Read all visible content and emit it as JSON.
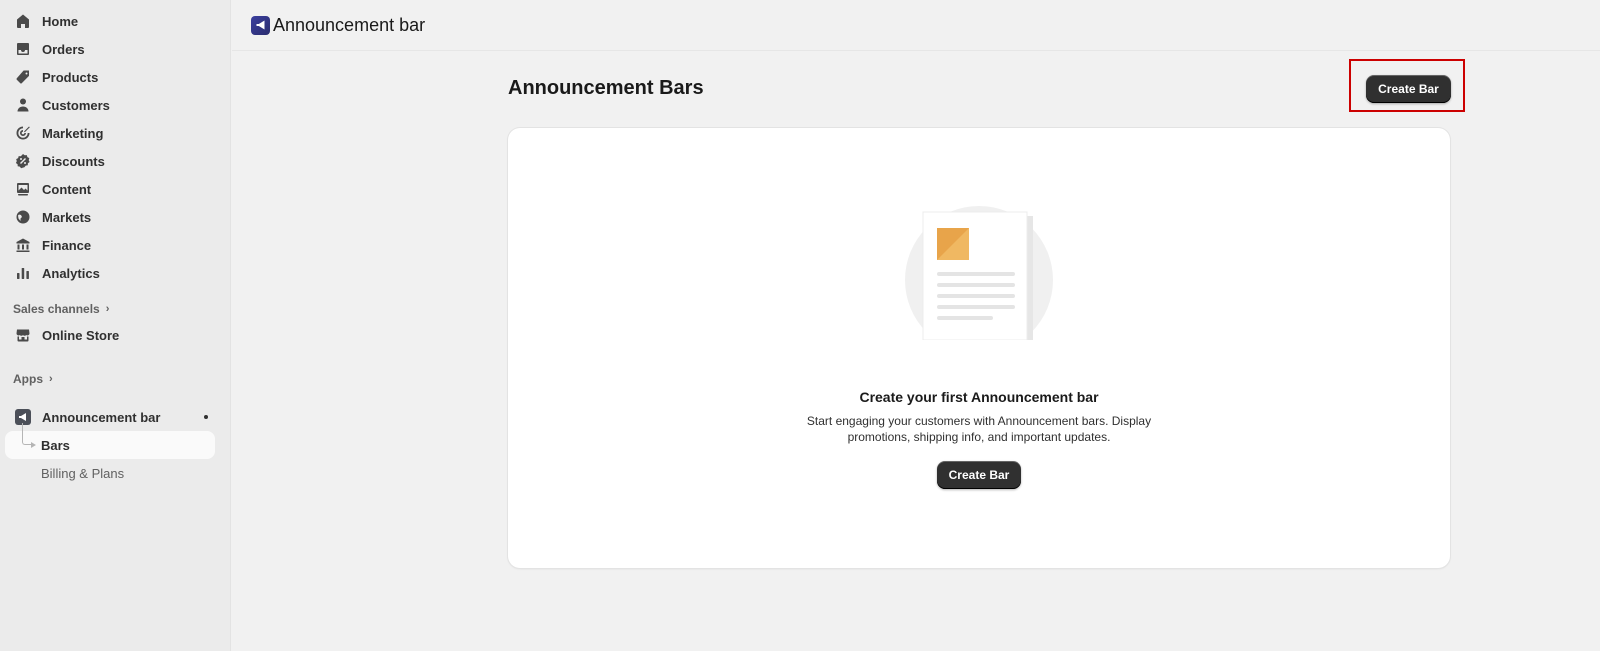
{
  "sidebar": {
    "nav": [
      {
        "label": "Home",
        "icon": "home-icon"
      },
      {
        "label": "Orders",
        "icon": "inbox-icon"
      },
      {
        "label": "Products",
        "icon": "tag-icon"
      },
      {
        "label": "Customers",
        "icon": "person-icon"
      },
      {
        "label": "Marketing",
        "icon": "target-icon"
      },
      {
        "label": "Discounts",
        "icon": "discount-icon"
      },
      {
        "label": "Content",
        "icon": "image-icon"
      },
      {
        "label": "Markets",
        "icon": "globe-icon"
      },
      {
        "label": "Finance",
        "icon": "bank-icon"
      },
      {
        "label": "Analytics",
        "icon": "bar-chart-icon"
      }
    ],
    "sales_channels_label": "Sales channels",
    "online_store_label": "Online Store",
    "apps_label": "Apps",
    "app_name": "Announcement bar",
    "sub_items": [
      "Bars",
      "Billing & Plans"
    ]
  },
  "topbar": {
    "title": "Announcement bar"
  },
  "main": {
    "heading": "Announcement Bars",
    "create_button_label": "Create Bar",
    "empty_state": {
      "title": "Create your first Announcement bar",
      "description": "Start engaging your customers with Announcement bars. Display promotions, shipping info, and important updates.",
      "button_label": "Create Bar"
    }
  },
  "colors": {
    "primary_button": "#303030",
    "highlight_border": "#cc0000",
    "illustration_accent": "#e8a44a"
  }
}
